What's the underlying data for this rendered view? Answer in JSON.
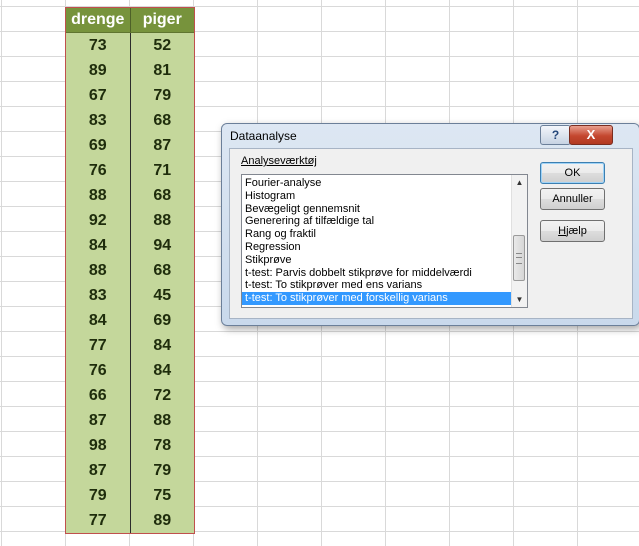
{
  "table": {
    "headers": [
      "drenge",
      "piger"
    ],
    "rows": [
      [
        "73",
        "52"
      ],
      [
        "89",
        "81"
      ],
      [
        "67",
        "79"
      ],
      [
        "83",
        "68"
      ],
      [
        "69",
        "87"
      ],
      [
        "76",
        "71"
      ],
      [
        "88",
        "68"
      ],
      [
        "92",
        "88"
      ],
      [
        "84",
        "94"
      ],
      [
        "88",
        "68"
      ],
      [
        "83",
        "45"
      ],
      [
        "84",
        "69"
      ],
      [
        "77",
        "84"
      ],
      [
        "76",
        "84"
      ],
      [
        "66",
        "72"
      ],
      [
        "87",
        "88"
      ],
      [
        "98",
        "78"
      ],
      [
        "87",
        "79"
      ],
      [
        "79",
        "75"
      ],
      [
        "77",
        "89"
      ]
    ]
  },
  "dialog": {
    "title": "Dataanalyse",
    "help_glyph": "?",
    "close_glyph": "X",
    "group_label": "Analyseværktøj",
    "items": [
      "Fourier-analyse",
      "Histogram",
      "Bevægeligt gennemsnit",
      "Generering af tilfældige tal",
      "Rang og fraktil",
      "Regression",
      "Stikprøve",
      "t-test: Parvis dobbelt stikprøve for middelværdi",
      "t-test: To stikprøver med ens varians",
      "t-test: To stikprøver med forskellig varians"
    ],
    "selected_index": 9,
    "buttons": {
      "ok": "OK",
      "cancel": "Annuller",
      "help_accel": "H",
      "help_rest": "jælp"
    },
    "scroll_up": "▲",
    "scroll_down": "▼"
  },
  "colors": {
    "header_bg": "#77933c",
    "cell_bg": "#c4d79b",
    "table_border": "#c0504d",
    "selection": "#3399ff"
  }
}
